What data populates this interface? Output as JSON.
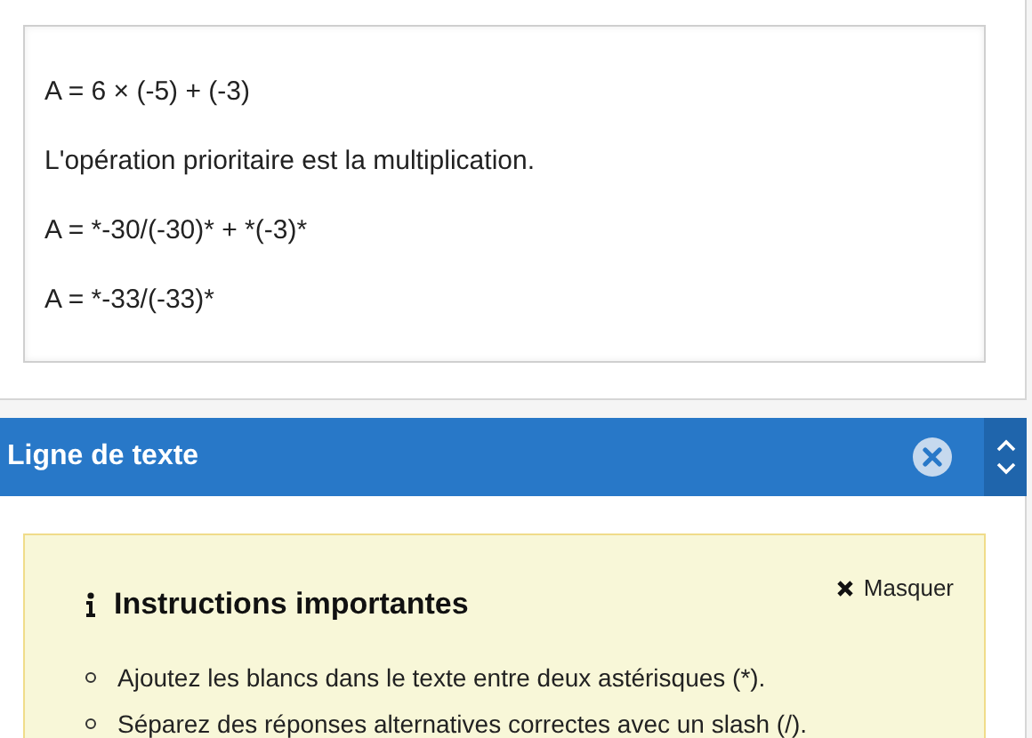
{
  "text_box": {
    "lines": [
      "A = 6 × (-5) + (-3)",
      "L'opération prioritaire est la multiplication.",
      "A = *-30/(-30)* + *(-3)*",
      "A = *-33/(-33)*"
    ]
  },
  "section_bar": {
    "title": "Ligne de texte"
  },
  "instructions": {
    "title": "Instructions importantes",
    "hide_label": "Masquer",
    "items": [
      "Ajoutez les blancs dans le texte entre deux astérisques (*).",
      "Séparez des réponses alternatives correctes avec un slash (/)."
    ]
  }
}
